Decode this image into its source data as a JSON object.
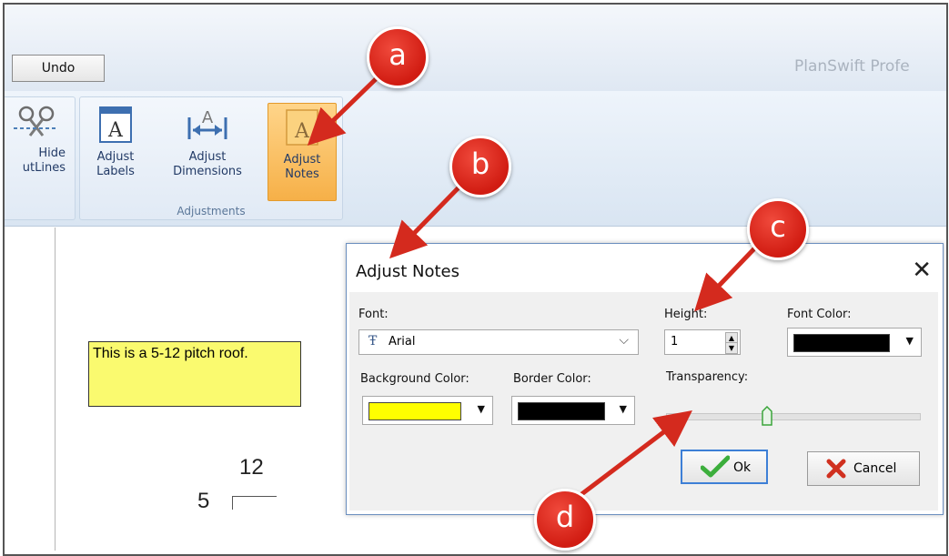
{
  "app": {
    "title": "PlanSwift Profe"
  },
  "toolbar": {
    "undo_label": "Undo"
  },
  "ribbon": {
    "partial_button": {
      "line1": "Hide",
      "line2": "utLines"
    },
    "group_label": "Adjustments",
    "buttons": [
      {
        "line1": "Adjust",
        "line2": "Labels"
      },
      {
        "line1": "Adjust",
        "line2": "Dimensions"
      },
      {
        "line1": "Adjust",
        "line2": "Notes"
      }
    ]
  },
  "canvas": {
    "note_text": "This is a 5-12 pitch roof.",
    "pitch_run": "12",
    "pitch_rise": "5"
  },
  "dialog": {
    "title": "Adjust Notes",
    "font_label": "Font:",
    "font_value": "Arial",
    "height_label": "Height:",
    "height_value": "1",
    "font_color_label": "Font Color:",
    "background_color_label": "Background Color:",
    "border_color_label": "Border Color:",
    "transparency_label": "Transparency:",
    "transparency_value": 0.4,
    "ok_label": "Ok",
    "cancel_label": "Cancel",
    "colors": {
      "font": "#000000",
      "background": "#ffff00",
      "border": "#000000"
    }
  },
  "callouts": [
    "a",
    "b",
    "c",
    "d"
  ],
  "colors": {
    "callout": "#d42a1e",
    "note_bg": "#fafa6f"
  }
}
